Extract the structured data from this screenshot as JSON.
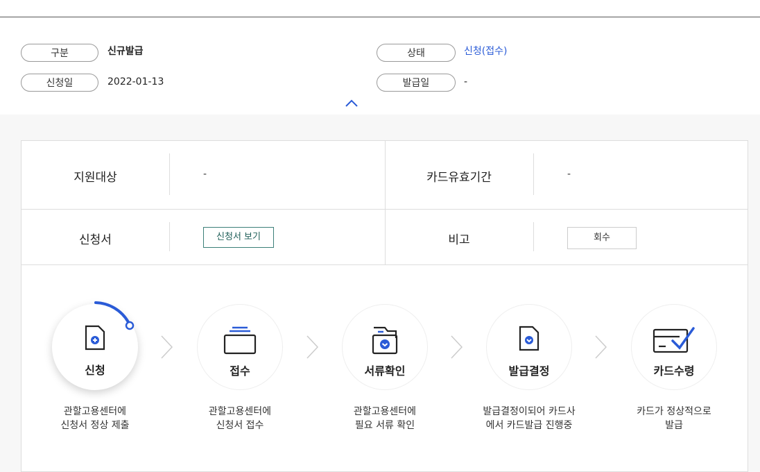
{
  "summary": {
    "type_label": "구분",
    "type_value": "신규발급",
    "status_label": "상태",
    "status_value": "신청(접수)",
    "apply_date_label": "신청일",
    "apply_date_value": "2022-01-13",
    "issue_date_label": "발급일",
    "issue_date_value": "-"
  },
  "details": {
    "target_label": "지원대상",
    "target_value": "-",
    "card_validity_label": "카드유효기간",
    "card_validity_value": "-",
    "application_label": "신청서",
    "view_application_button": "신청서 보기",
    "remarks_label": "비고",
    "recall_button": "회수"
  },
  "steps": [
    {
      "label": "신청",
      "desc": "관할고용센터에\n신청서 정상 제출",
      "icon": "document-plus-icon"
    },
    {
      "label": "접수",
      "desc": "관할고용센터에\n신청서 접수",
      "icon": "folder-icon"
    },
    {
      "label": "서류확인",
      "desc": "관할고용센터에\n필요 서류 확인",
      "icon": "folder-check-icon"
    },
    {
      "label": "발급결정",
      "desc": "발급결정이되어 카드사\n에서 카드발급 진행중",
      "icon": "document-check-icon"
    },
    {
      "label": "카드수령",
      "desc": "카드가 정상적으로\n발급",
      "icon": "card-check-icon"
    }
  ],
  "colors": {
    "accent": "#2a5bd7",
    "button_border": "#3b7f78"
  }
}
